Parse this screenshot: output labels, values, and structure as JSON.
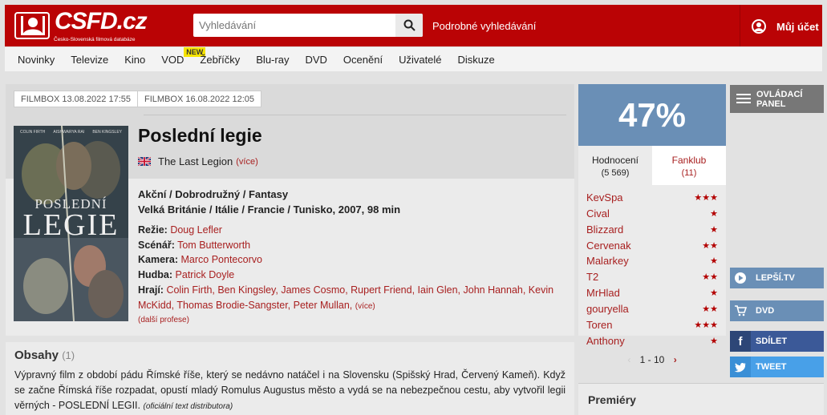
{
  "header": {
    "logo_main": "CSFD.cz",
    "logo_sub": "Česko-Slovenská filmová databáze",
    "search_placeholder": "Vyhledávání",
    "advanced_search": "Podrobné vyhledávání",
    "account": "Můj účet"
  },
  "nav": {
    "items": [
      "Novinky",
      "Televize",
      "Kino",
      "VOD",
      "Žebříčky",
      "Blu-ray",
      "DVD",
      "Ocenění",
      "Uživatelé",
      "Diskuze"
    ],
    "vod_badge": "NEW"
  },
  "film": {
    "tags": [
      "FILMBOX 13.08.2022 17:55",
      "FILMBOX 16.08.2022 12:05"
    ],
    "title": "Poslední legie",
    "original_title": "The Last Legion",
    "original_more": "(více)",
    "genre": "Akční / Dobrodružný / Fantasy",
    "origin": "Velká Británie / Itálie / Francie / Tunisko, 2007, 98 min",
    "poster": {
      "title_line1": "POSLEDNÍ",
      "title_line2": "LEGIE",
      "names": [
        "COLIN FIRTH",
        "AISHWARYA RAI",
        "BEN KINGSLEY"
      ]
    },
    "crew": {
      "director_label": "Režie:",
      "director": "Doug Lefler",
      "writer_label": "Scénář:",
      "writer": "Tom Butterworth",
      "camera_label": "Kamera:",
      "camera": "Marco Pontecorvo",
      "music_label": "Hudba:",
      "music": "Patrick Doyle",
      "cast_label": "Hrají:",
      "cast": "Colin Firth, Ben Kingsley, James Cosmo, Rupert Friend, Iain Glen, John Hannah, Kevin McKidd, Thomas Brodie-Sangster, Peter Mullan,",
      "cast_more": "(více)",
      "more_professions": "(další profese)"
    }
  },
  "plot": {
    "heading": "Obsahy",
    "count": "(1)",
    "text": "Výpravný film z období pádu Římské říše, který se nedávno natáčel i na Slovensku (Spišský Hrad, Červený Kameň). Když se začne Římská říše rozpadat, opustí mladý Romulus Augustus město a vydá se na nebezpečnou cestu, aby vytvořil legii věrných - POSLEDNÍ LEGII.",
    "source": "(oficiální text distributora)"
  },
  "rating": {
    "percent": "47%",
    "tab_ratings": "Hodnocení",
    "tab_ratings_count": "(5 569)",
    "tab_fanclub": "Fanklub",
    "tab_fanclub_count": "(11)",
    "users": [
      {
        "name": "KevSpa",
        "stars": 3
      },
      {
        "name": "Cival",
        "stars": 1
      },
      {
        "name": "Blizzard",
        "stars": 1
      },
      {
        "name": "Cervenak",
        "stars": 2
      },
      {
        "name": "Malarkey",
        "stars": 1
      },
      {
        "name": "T2",
        "stars": 2
      },
      {
        "name": "MrHlad",
        "stars": 1
      },
      {
        "name": "gouryella",
        "stars": 2
      },
      {
        "name": "Toren",
        "stars": 3
      },
      {
        "name": "Anthony",
        "stars": 1
      }
    ],
    "pager": "1 - 10"
  },
  "premiery": "Premiéry",
  "sidebar": {
    "control_panel": "OVLÁDACÍ PANEL",
    "buttons": [
      {
        "label": "LEPŠÍ.TV",
        "color": "#6a8fb6"
      },
      {
        "label": "DVD",
        "color": "#6a8fb6"
      },
      {
        "label": "SDÍLET",
        "color": "#3b5998"
      },
      {
        "label": "TWEET",
        "color": "#48a0e8"
      }
    ]
  },
  "colors": {
    "brand": "#ba0305",
    "link": "#a82020",
    "rating_bg": "#6a8fb6"
  }
}
